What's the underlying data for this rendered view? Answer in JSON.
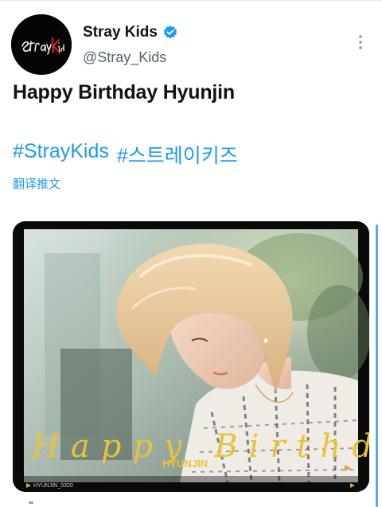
{
  "tweet": {
    "author": {
      "display_name": "Stray Kids",
      "handle": "@Stray_Kids",
      "verified": true,
      "avatar_logo_text": "Stray Kids"
    },
    "text": "Happy Birthday Hyunjin",
    "hashtags": [
      "#StrayKids",
      "#스트레이키즈"
    ],
    "translate_label": "翻译推文",
    "media": {
      "overlay_script": "Happy Birthday",
      "overlay_name": "HYUNJIN",
      "corner_caption": "HYUNJIN_0320"
    }
  },
  "icons": {
    "verified": "verified-badge-icon",
    "more": "more-options-icon"
  },
  "colors": {
    "link": "#1d9bf0",
    "text": "#0f1419",
    "secondary": "#536471",
    "gold": "#e9c23a"
  }
}
